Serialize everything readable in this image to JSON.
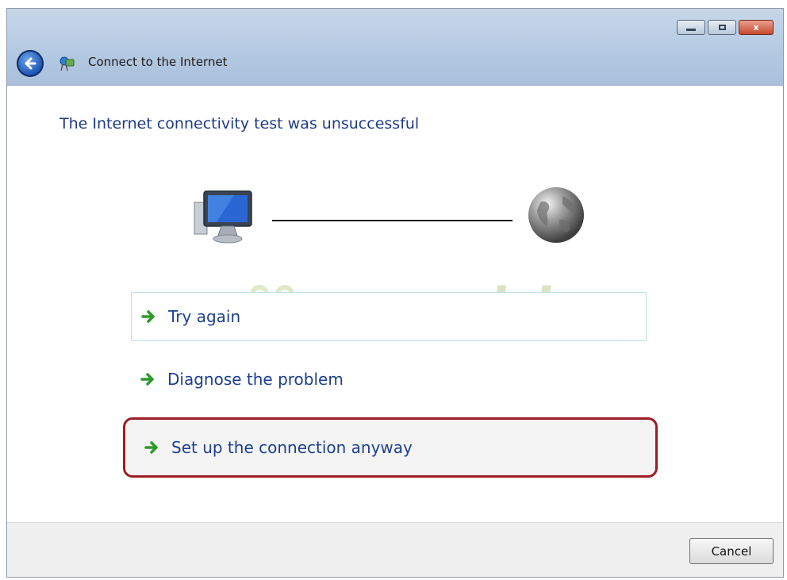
{
  "window": {
    "title": "Connect to the Internet",
    "controls": {
      "minimize_icon": "minimize-icon",
      "maximize_icon": "maximize-icon",
      "close_label": "x"
    }
  },
  "main": {
    "heading": "The Internet connectivity test was unsuccessful",
    "status_visual": {
      "left_icon": "computer-icon",
      "right_icon": "globe-icon",
      "connection": "line"
    },
    "options": [
      {
        "label": "Try again",
        "icon": "green-arrow-icon"
      },
      {
        "label": "Diagnose the problem",
        "icon": "green-arrow-icon"
      },
      {
        "label": "Set up the connection anyway",
        "icon": "green-arrow-icon",
        "highlighted": true
      }
    ]
  },
  "watermark": {
    "text": "sapoadsl"
  },
  "footer": {
    "cancel_label": "Cancel"
  },
  "colors": {
    "heading": "#1f3a8a",
    "option_text": "#1c3f8f",
    "arrow_green": "#2e9a2a",
    "highlight_border": "#9c1d24",
    "titlebar": "#b9cde4"
  }
}
